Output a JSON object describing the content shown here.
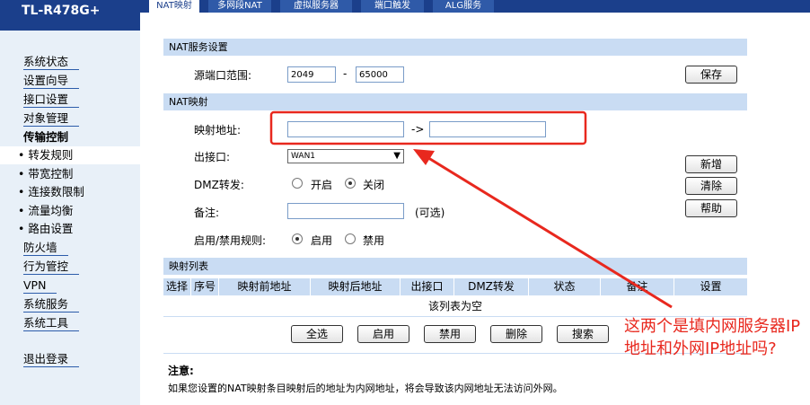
{
  "brand": "TL-R478G+",
  "tabs": [
    "NAT映射",
    "多网段NAT",
    "虚拟服务器",
    "端口触发",
    "ALG服务"
  ],
  "sidebar": {
    "items": [
      "系统状态",
      "设置向导",
      "接口设置",
      "对象管理",
      "传输控制"
    ],
    "sub_items": [
      "• 转发规则",
      "• 带宽控制",
      "• 连接数限制",
      "• 流量均衡",
      "• 路由设置"
    ],
    "items2": [
      "防火墙",
      "行为管控",
      "VPN",
      "系统服务",
      "系统工具"
    ],
    "logout": "退出登录"
  },
  "nat_service": {
    "header": "NAT服务设置",
    "port_range_label": "源端口范围:",
    "port_start": "2049",
    "dash": "-",
    "port_end": "65000",
    "save": "保存"
  },
  "nat_map": {
    "header": "NAT映射",
    "map_addr_label": "映射地址:",
    "arrow": "->",
    "out_if_label": "出接口:",
    "out_if_value": "WAN1",
    "dmz_label": "DMZ转发:",
    "dmz_on": "开启",
    "dmz_off": "关闭",
    "note_label": "备注:",
    "optional": "(可选)",
    "rule_label": "启用/禁用规则:",
    "enable": "启用",
    "disable": "禁用",
    "btn_new": "新增",
    "btn_clear": "清除",
    "btn_help": "帮助"
  },
  "map_list": {
    "header": "映射列表",
    "columns": [
      "选择",
      "序号",
      "映射前地址",
      "映射后地址",
      "出接口",
      "DMZ转发",
      "状态",
      "备注",
      "设置"
    ],
    "empty": "该列表为空",
    "actions": [
      "全选",
      "启用",
      "禁用",
      "删除",
      "搜索"
    ]
  },
  "note": {
    "title": "注意:",
    "text": "如果您设置的NAT映射条目映射后的地址为内网地址，将会导致该内网地址无法访问外网。"
  },
  "annotation": "这两个是填内网服务器IP地址和外网IP地址吗?",
  "colors": {
    "brand": "#1b3f8b",
    "section": "#c9dcf3",
    "annotation": "#e8281e"
  }
}
